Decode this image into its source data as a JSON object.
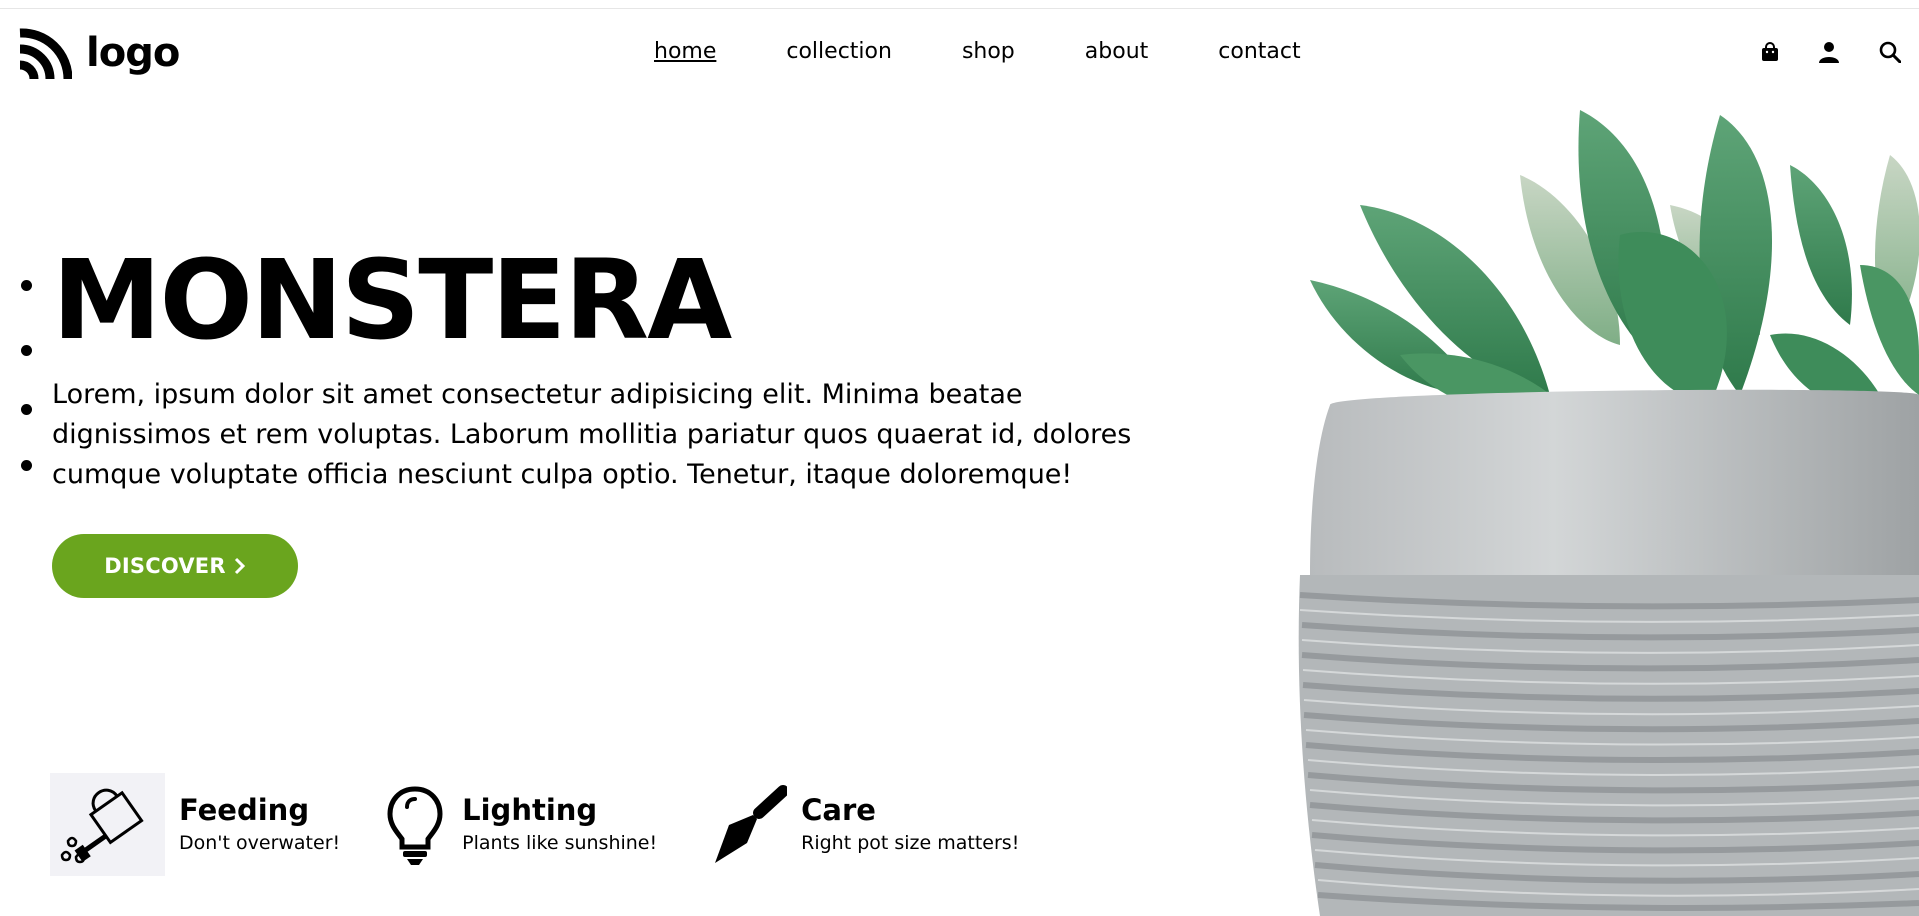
{
  "header": {
    "logo_text": "logo",
    "nav": [
      {
        "label": "home",
        "active": true
      },
      {
        "label": "collection",
        "active": false
      },
      {
        "label": "shop",
        "active": false
      },
      {
        "label": "about",
        "active": false
      },
      {
        "label": "contact",
        "active": false
      }
    ],
    "icons": [
      "shopping-bag-icon",
      "user-icon",
      "search-icon"
    ]
  },
  "hero": {
    "title": "MONSTERA",
    "text": "Lorem, ipsum dolor sit amet consectetur adipisicing elit. Minima beatae dignissimos et rem voluptas. Laborum mollitia pariatur quos quaerat id, dolores cumque voluptate officia nesciunt culpa optio. Tenetur, itaque doloremque!",
    "button_label": "DISCOVER",
    "button_color": "#6aa51e"
  },
  "features": [
    {
      "title": "Feeding",
      "subtitle": "Don't overwater!",
      "icon": "watering-can-icon"
    },
    {
      "title": "Lighting",
      "subtitle": "Plants like sunshine!",
      "icon": "light-bulb-icon"
    },
    {
      "title": "Care",
      "subtitle": "Right pot size matters!",
      "icon": "trowel-icon"
    }
  ],
  "colors": {
    "accent": "#6aa51e",
    "feature_icon_bg": "#f2f2f6"
  }
}
